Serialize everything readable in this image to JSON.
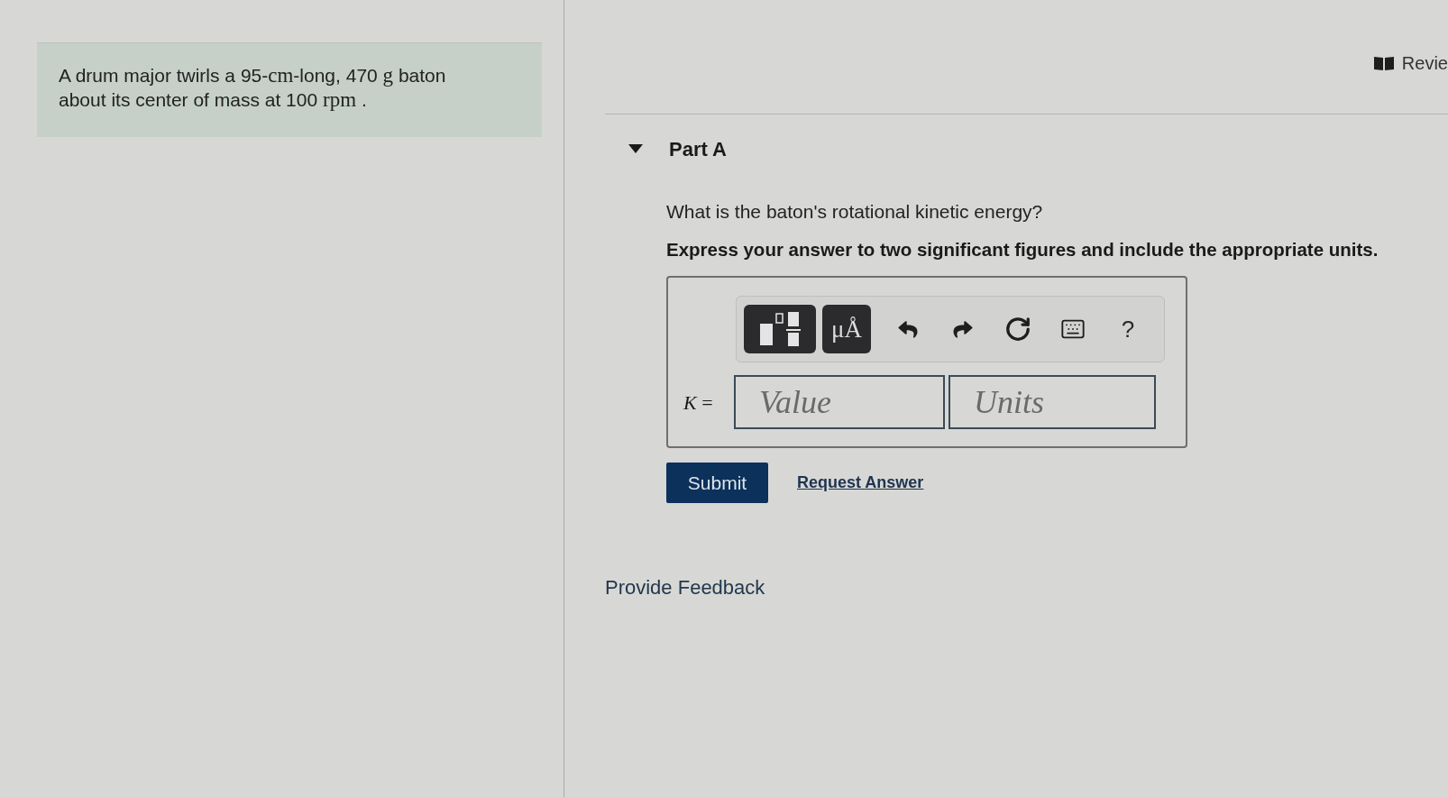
{
  "problem": {
    "segments": [
      {
        "kind": "text",
        "text": "A drum major twirls a 95-"
      },
      {
        "kind": "unit",
        "text": "cm"
      },
      {
        "kind": "text",
        "text": "-long, 470 "
      },
      {
        "kind": "unit",
        "text": "g"
      },
      {
        "kind": "text",
        "text": " baton about its center of mass at 100 "
      },
      {
        "kind": "unit",
        "text": "rpm"
      },
      {
        "kind": "text",
        "text": " ."
      }
    ]
  },
  "review_link": {
    "label": "Revie"
  },
  "part": {
    "title": "Part A",
    "expanded": true,
    "question": "What is the baton's rotational kinetic energy?",
    "instruction": "Express your answer to two significant figures and include the appropriate units.",
    "toolbar": [
      {
        "kind": "templates"
      },
      {
        "kind": "symbols",
        "label": "μÅ"
      },
      {
        "kind": "undo"
      },
      {
        "kind": "redo"
      },
      {
        "kind": "reset"
      },
      {
        "kind": "keyboard"
      },
      {
        "kind": "help",
        "label": "?"
      }
    ],
    "answer_label": "*K* =",
    "value_field": {
      "placeholder": "Value"
    },
    "units_field": {
      "placeholder": "Units"
    },
    "submit": "Submit",
    "request_answer": "Request Answer"
  },
  "feedback_link": "Provide Feedback"
}
